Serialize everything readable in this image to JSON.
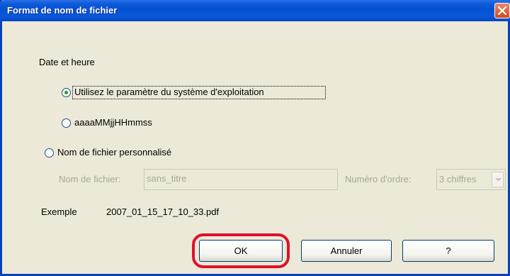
{
  "dialog": {
    "title": "Format de nom de fichier",
    "icons": {
      "close": "close-icon",
      "dropdown": "chevron-down-icon"
    },
    "colors": {
      "title_bar": "#0451d2",
      "highlight": "#e0112c",
      "radio_selected": "#21a121"
    }
  },
  "datetime": {
    "group_label": "Date et heure",
    "option_os": "Utilisez le paramètre du système d'exploitation",
    "option_format": "aaaaMMjjHHmmss",
    "selected": "option_os"
  },
  "custom": {
    "option_label": "Nom de fichier personnalisé",
    "filename_label": "Nom de fichier:",
    "filename_value": "sans_titre",
    "order_label": "Numéro d'ordre:",
    "order_value": "3 chiffres",
    "enabled": false
  },
  "example": {
    "label": "Exemple",
    "value": "2007_01_15_17_10_33.pdf"
  },
  "buttons": {
    "ok": "OK",
    "cancel": "Annuler",
    "help": "?"
  }
}
